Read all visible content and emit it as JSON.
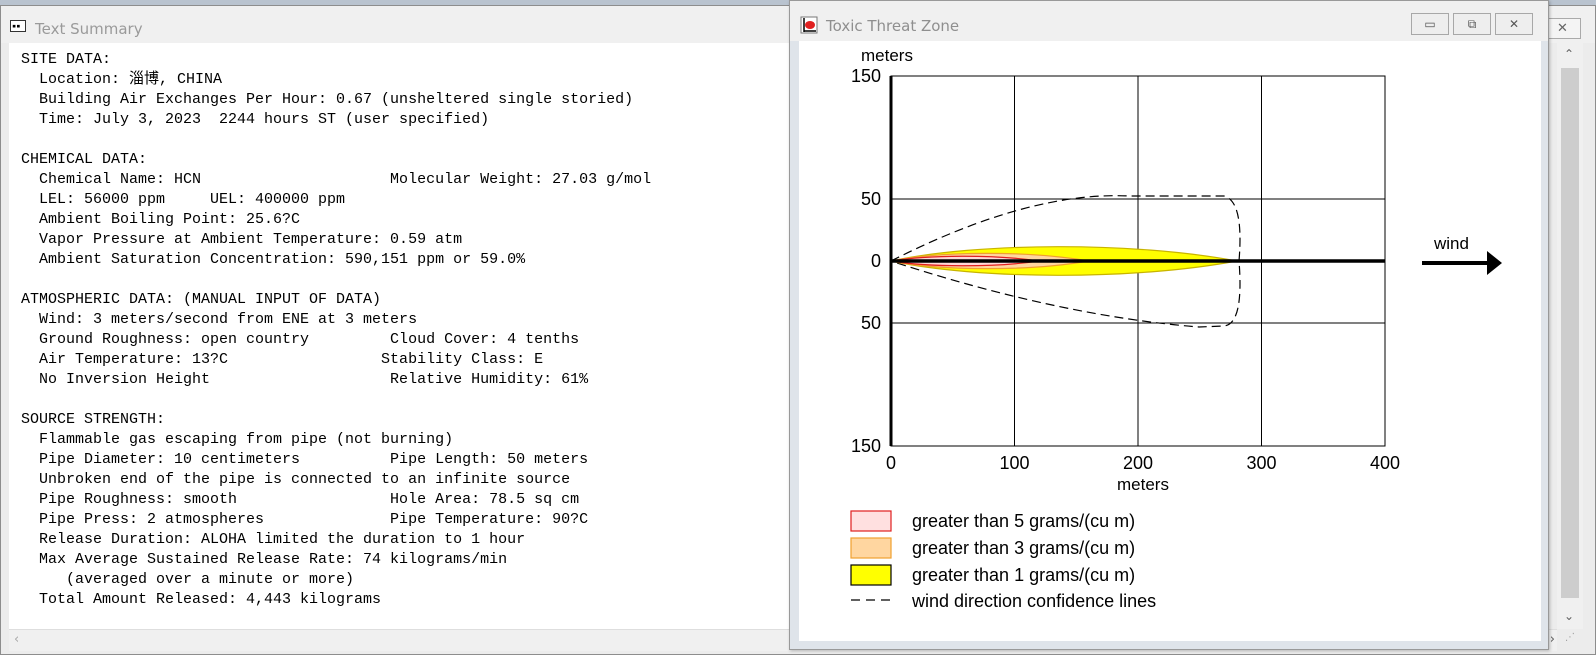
{
  "summary_window": {
    "title": "Text Summary",
    "icon": "text-document-icon",
    "close_glyph": "✕",
    "lines": [
      "SITE DATA:",
      "  Location: 淄博, CHINA",
      "  Building Air Exchanges Per Hour: 0.67 (unsheltered single storied)",
      "  Time: July 3, 2023  2244 hours ST (user specified)",
      "",
      "CHEMICAL DATA:",
      "  Chemical Name: HCN                     Molecular Weight: 27.03 g/mol",
      "  LEL: 56000 ppm     UEL: 400000 ppm",
      "  Ambient Boiling Point: 25.6?C",
      "  Vapor Pressure at Ambient Temperature: 0.59 atm",
      "  Ambient Saturation Concentration: 590,151 ppm or 59.0%",
      "",
      "ATMOSPHERIC DATA: (MANUAL INPUT OF DATA)",
      "  Wind: 3 meters/second from ENE at 3 meters",
      "  Ground Roughness: open country         Cloud Cover: 4 tenths",
      "  Air Temperature: 13?C                 Stability Class: E",
      "  No Inversion Height                    Relative Humidity: 61%",
      "",
      "SOURCE STRENGTH:",
      "  Flammable gas escaping from pipe (not burning)",
      "  Pipe Diameter: 10 centimeters          Pipe Length: 50 meters",
      "  Unbroken end of the pipe is connected to an infinite source",
      "  Pipe Roughness: smooth                 Hole Area: 78.5 sq cm",
      "  Pipe Press: 2 atmospheres              Pipe Temperature: 90?C",
      "  Release Duration: ALOHA limited the duration to 1 hour",
      "  Max Average Sustained Release Rate: 74 kilograms/min",
      "     (averaged over a minute or more)",
      "  Total Amount Released: 4,443 kilograms"
    ]
  },
  "threat_window": {
    "title": "Toxic Threat Zone",
    "icon": "threat-zone-icon",
    "buttons": {
      "minimize": "▭",
      "maximize": "⧉",
      "close": "✕"
    },
    "plot": {
      "y_axis_label": "meters",
      "x_axis_label": "meters",
      "wind_label": "wind",
      "x_ticks": [
        "0",
        "100",
        "200",
        "300",
        "400"
      ],
      "y_ticks": [
        "150",
        "50",
        "0",
        "50",
        "150"
      ],
      "x_range": [
        0,
        400
      ],
      "y_range": [
        -150,
        150
      ],
      "zones": [
        {
          "name": "greater than 1 grams/(cu m)",
          "color": "#ffff00",
          "edge": "#c8b400",
          "length_m": 280,
          "halfwidth_m": 15
        },
        {
          "name": "greater than 3 grams/(cu m)",
          "color": "#ffd6a0",
          "edge": "#f0a030",
          "length_m": 160,
          "halfwidth_m": 8
        },
        {
          "name": "greater than 5 grams/(cu m)",
          "color": "#ffd8d8",
          "edge": "#e02020",
          "length_m": 120,
          "halfwidth_m": 5
        }
      ],
      "confidence_line_label": "wind direction confidence lines",
      "legend": [
        "greater than 5 grams/(cu m)",
        "greater than 3 grams/(cu m)",
        "greater than 1 grams/(cu m)",
        "wind direction confidence lines"
      ]
    }
  }
}
